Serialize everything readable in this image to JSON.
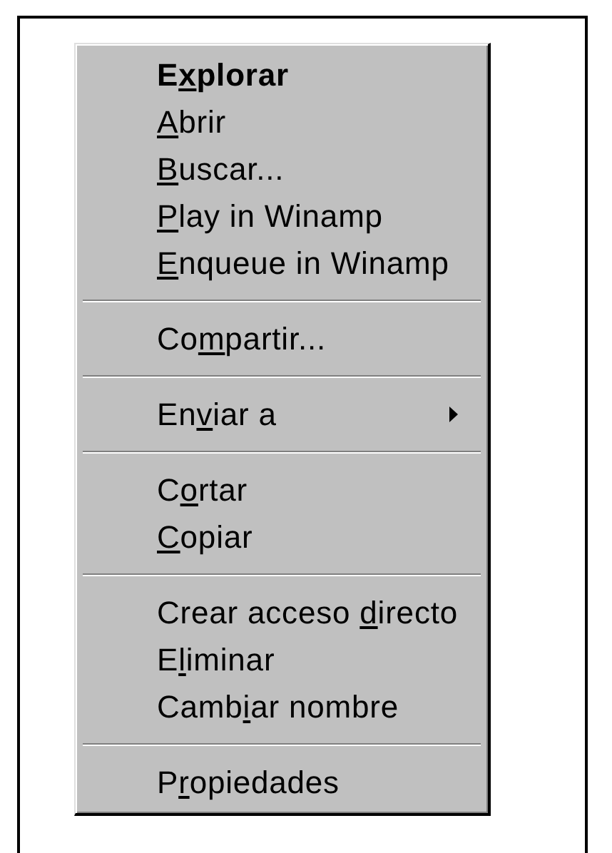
{
  "context_menu": {
    "entries": [
      {
        "kind": "item",
        "text": {
          "before": "E",
          "key": "x",
          "after": "plorar"
        },
        "default": true,
        "submenu": false
      },
      {
        "kind": "item",
        "text": {
          "key": "A",
          "after": "brir"
        },
        "default": false,
        "submenu": false
      },
      {
        "kind": "item",
        "text": {
          "key": "B",
          "after": "uscar..."
        },
        "default": false,
        "submenu": false
      },
      {
        "kind": "item",
        "text": {
          "key": "P",
          "after": "lay in Winamp"
        },
        "default": false,
        "submenu": false
      },
      {
        "kind": "item",
        "text": {
          "key": "E",
          "after": "nqueue in Winamp"
        },
        "default": false,
        "submenu": false
      },
      {
        "kind": "separator"
      },
      {
        "kind": "item",
        "text": {
          "before": "Co",
          "key": "m",
          "after": "partir..."
        },
        "default": false,
        "submenu": false
      },
      {
        "kind": "separator"
      },
      {
        "kind": "item",
        "text": {
          "before": "En",
          "key": "v",
          "after": "iar a"
        },
        "default": false,
        "submenu": true
      },
      {
        "kind": "separator"
      },
      {
        "kind": "item",
        "text": {
          "before": "C",
          "key": "o",
          "after": "rtar"
        },
        "default": false,
        "submenu": false
      },
      {
        "kind": "item",
        "text": {
          "key": "C",
          "after": "opiar"
        },
        "default": false,
        "submenu": false
      },
      {
        "kind": "separator"
      },
      {
        "kind": "item",
        "text": {
          "before": "Crear acceso ",
          "key": "d",
          "after": "irecto"
        },
        "default": false,
        "submenu": false
      },
      {
        "kind": "item",
        "text": {
          "before": "E",
          "key": "l",
          "after": "iminar"
        },
        "default": false,
        "submenu": false
      },
      {
        "kind": "item",
        "text": {
          "before": "Camb",
          "key": "i",
          "after": "ar nombre"
        },
        "default": false,
        "submenu": false
      },
      {
        "kind": "separator"
      },
      {
        "kind": "item",
        "text": {
          "before": "P",
          "key": "r",
          "after": "opiedades"
        },
        "default": false,
        "submenu": false
      }
    ]
  }
}
